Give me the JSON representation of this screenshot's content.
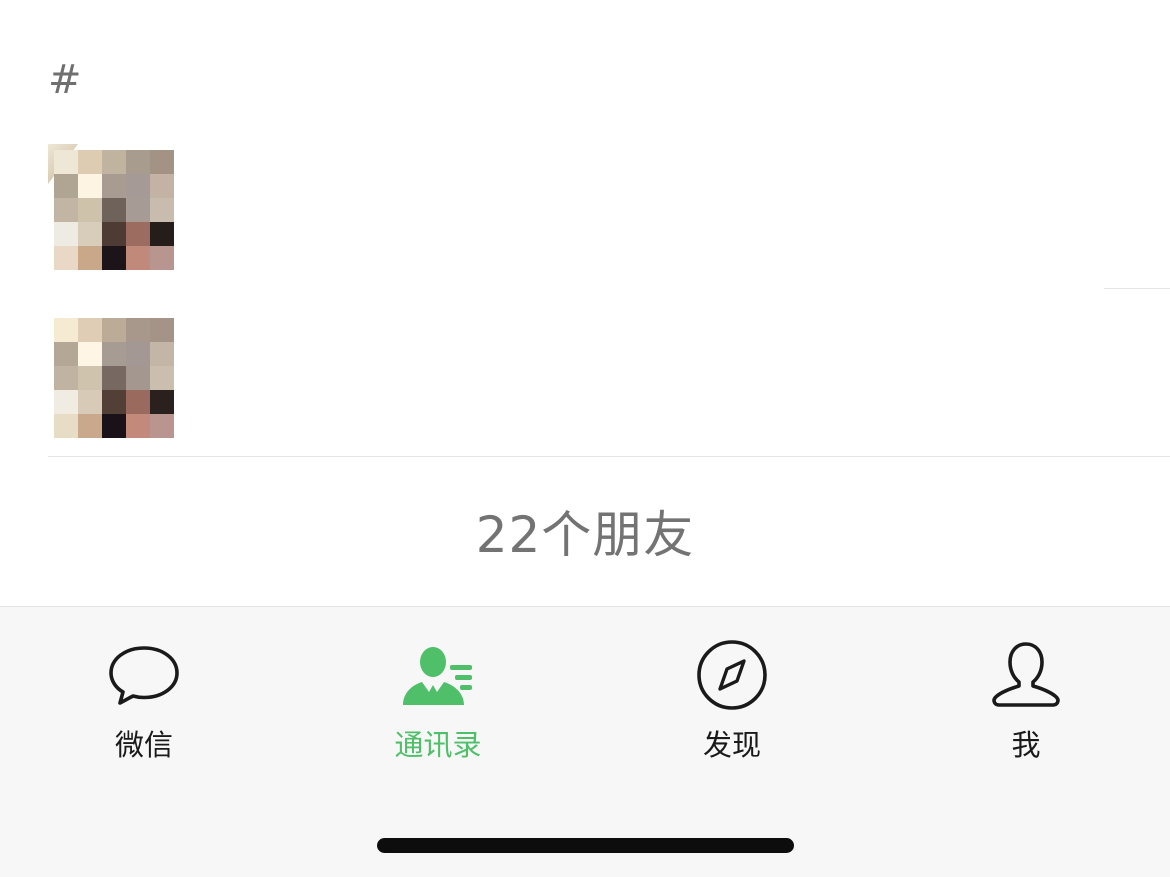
{
  "contacts": {
    "section_index": "#",
    "friend_count_text": "22个朋友"
  },
  "tab_bar": {
    "accent_color": "#4fbf69",
    "tabs": [
      {
        "label": "微信",
        "icon": "chat-bubble-icon",
        "active": false
      },
      {
        "label": "通讯录",
        "icon": "contacts-icon",
        "active": true
      },
      {
        "label": "发现",
        "icon": "compass-icon",
        "active": false
      },
      {
        "label": "我",
        "icon": "person-icon",
        "active": false
      }
    ]
  }
}
